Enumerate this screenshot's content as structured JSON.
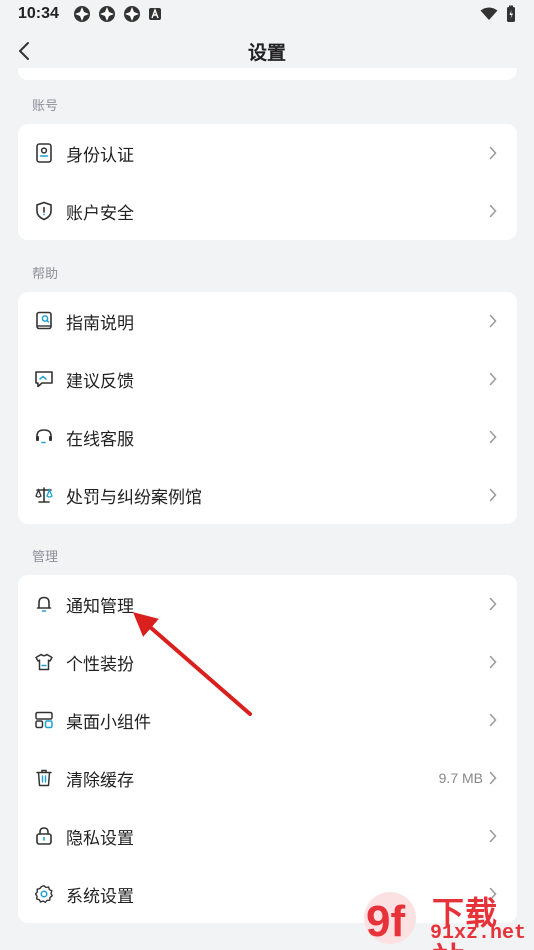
{
  "status_bar": {
    "time": "10:34"
  },
  "header": {
    "title": "设置"
  },
  "sections": [
    {
      "label": "账号",
      "items": [
        {
          "label": "身份认证",
          "icon": "id-card-icon"
        },
        {
          "label": "账户安全",
          "icon": "shield-icon"
        }
      ]
    },
    {
      "label": "帮助",
      "items": [
        {
          "label": "指南说明",
          "icon": "guide-book-icon"
        },
        {
          "label": "建议反馈",
          "icon": "feedback-icon"
        },
        {
          "label": "在线客服",
          "icon": "headset-icon"
        },
        {
          "label": "处罚与纠纷案例馆",
          "icon": "scale-icon"
        }
      ]
    },
    {
      "label": "管理",
      "items": [
        {
          "label": "通知管理",
          "icon": "bell-icon"
        },
        {
          "label": "个性装扮",
          "icon": "shirt-icon"
        },
        {
          "label": "桌面小组件",
          "icon": "widget-icon"
        },
        {
          "label": "清除缓存",
          "icon": "trash-icon",
          "value": "9.7 MB"
        },
        {
          "label": "隐私设置",
          "icon": "lock-icon"
        },
        {
          "label": "系统设置",
          "icon": "gear-icon"
        }
      ]
    }
  ],
  "watermark": {
    "line1": "下载站",
    "line2": "91xz.net",
    "logo": "9f"
  },
  "colors": {
    "annotation_arrow": "#d9201f",
    "accent_icon": "#1fa3d4",
    "watermark": "#e8323a"
  }
}
